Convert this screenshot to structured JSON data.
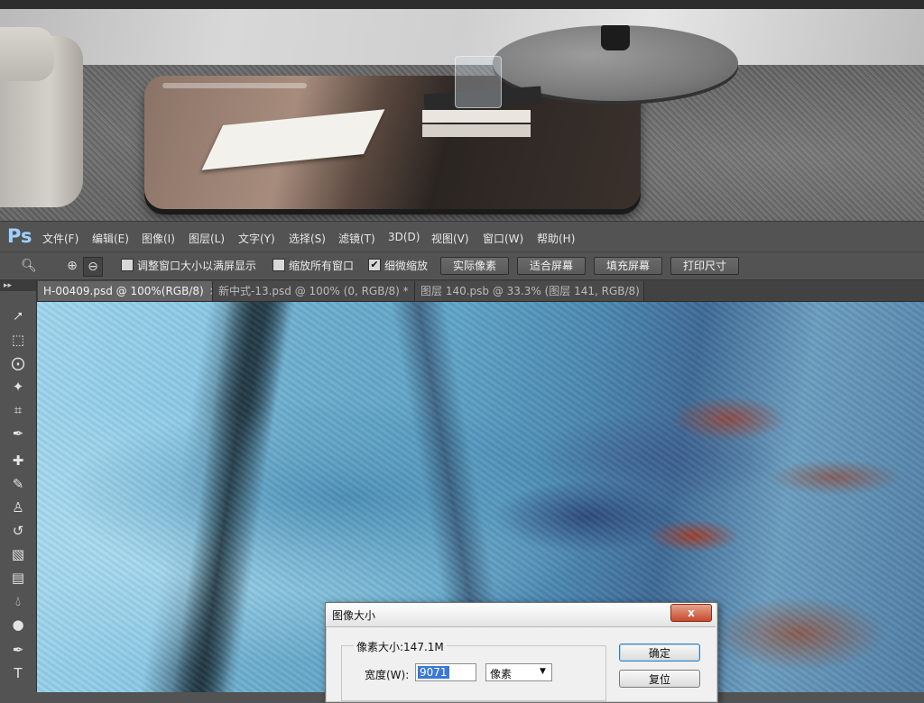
{
  "app": {
    "logo": "Ps"
  },
  "menu": [
    "文件(F)",
    "编辑(E)",
    "图像(I)",
    "图层(L)",
    "文字(Y)",
    "选择(S)",
    "滤镜(T)",
    "3D(D)",
    "视图(V)",
    "窗口(W)",
    "帮助(H)"
  ],
  "options": {
    "resize_windows": "调整窗口大小以满屏显示",
    "zoom_all": "缩放所有窗口",
    "scrubby_zoom": "细微缩放",
    "actual_pixels": "实际像素",
    "fit_screen": "适合屏幕",
    "fill_screen": "填充屏幕",
    "print_size": "打印尺寸",
    "resize_checked": false,
    "zoom_all_checked": false,
    "scrubby_checked": true
  },
  "tabs": [
    {
      "label": "H-00409.psd @ 100%(RGB/8)",
      "active": true
    },
    {
      "label": "新中式-13.psd @ 100% (0, RGB/8) *",
      "active": false
    },
    {
      "label": "图层 140.psb @ 33.3% (图层 141, RGB/8)",
      "active": false
    }
  ],
  "tools": [
    "move-icon",
    "marquee-icon",
    "lasso-icon",
    "magic-wand-icon",
    "crop-icon",
    "eyedropper-icon",
    "healing-brush-icon",
    "brush-icon",
    "stamp-icon",
    "history-brush-icon",
    "eraser-icon",
    "gradient-icon",
    "blur-icon",
    "dodge-icon",
    "pen-icon",
    "type-icon"
  ],
  "dialog": {
    "title": "图像大小",
    "close": "x",
    "pixel_dimensions": "像素大小:147.1M",
    "width_label": "宽度(W):",
    "width_value": "9071",
    "unit": "像素",
    "ok": "确定",
    "reset": "复位"
  },
  "colors": {
    "accent": "#3a79d4",
    "ps_logo": "#9fd1ff",
    "panel": "#535353"
  }
}
